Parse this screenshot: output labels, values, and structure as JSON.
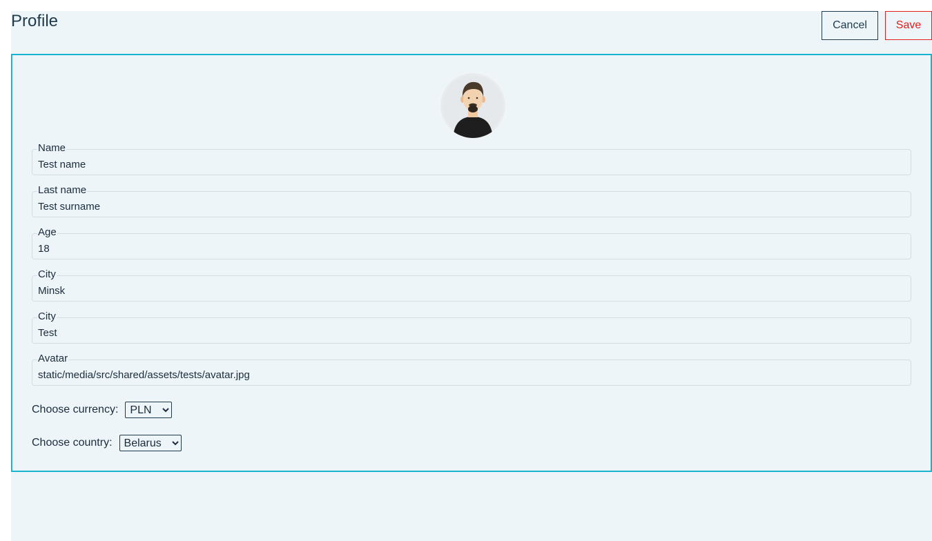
{
  "header": {
    "title": "Profile",
    "cancel_label": "Cancel",
    "save_label": "Save"
  },
  "avatar": {
    "alt": "avatar"
  },
  "fields": [
    {
      "label": "Name",
      "value": "Test name"
    },
    {
      "label": "Last name",
      "value": "Test surname"
    },
    {
      "label": "Age",
      "value": "18"
    },
    {
      "label": "City",
      "value": "Minsk"
    },
    {
      "label": "City",
      "value": "Test"
    },
    {
      "label": "Avatar",
      "value": "static/media/src/shared/assets/tests/avatar.jpg"
    }
  ],
  "currency": {
    "label": "Choose currency:",
    "selected": "PLN"
  },
  "country": {
    "label": "Choose country:",
    "selected": "Belarus"
  },
  "colors": {
    "accent": "#17b3cf",
    "danger": "#e11d1d",
    "text": "#1f3a4d",
    "background": "#edf5f8"
  }
}
